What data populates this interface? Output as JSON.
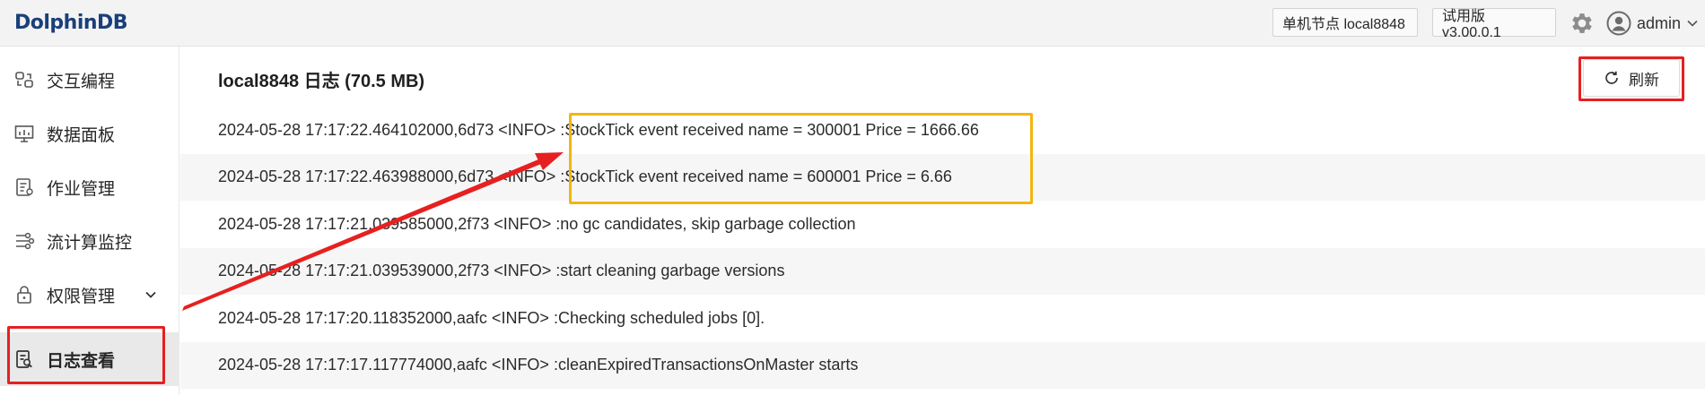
{
  "app": {
    "logo_text": "DolphinDB"
  },
  "header": {
    "node_label": "单机节点 local8848",
    "version_label": "试用版 v3.00.0.1",
    "user_name": "admin",
    "icons": {
      "settings": "gear-icon",
      "user": "user-avatar-icon",
      "dropdown": "chevron-down-icon"
    }
  },
  "sidebar": {
    "items": [
      {
        "label": "交互编程",
        "icon": "interactive-icon"
      },
      {
        "label": "数据面板",
        "icon": "dashboard-icon"
      },
      {
        "label": "作业管理",
        "icon": "job-icon"
      },
      {
        "label": "流计算监控",
        "icon": "stream-icon"
      },
      {
        "label": "权限管理",
        "icon": "lock-icon"
      },
      {
        "label": "日志查看",
        "icon": "log-view-icon",
        "active": true
      }
    ]
  },
  "main": {
    "title": "local8848 日志 (70.5 MB)",
    "refresh_label": "刷新",
    "logs": [
      "2024-05-28 17:17:22.464102000,6d73 <INFO> :StockTick event received name = 300001 Price = 1666.66",
      "2024-05-28 17:17:22.463988000,6d73 <INFO> :StockTick event received name = 600001 Price = 6.66",
      "2024-05-28 17:17:21.039585000,2f73 <INFO> :no gc candidates, skip garbage collection",
      "2024-05-28 17:17:21.039539000,2f73 <INFO> :start cleaning garbage versions",
      "2024-05-28 17:17:20.118352000,aafc <INFO> :Checking scheduled jobs [0].",
      "2024-05-28 17:17:17.117774000,aafc <INFO> :cleanExpiredTransactionsOnMaster starts"
    ]
  },
  "colors": {
    "annotation_red": "#e62020",
    "annotation_yellow": "#f3b512",
    "brand": "#1a3f7a"
  }
}
